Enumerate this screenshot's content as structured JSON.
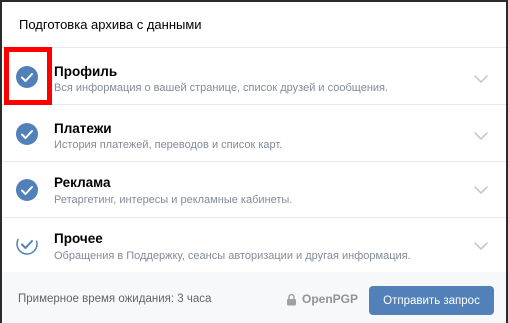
{
  "header": {
    "title": "Подготовка архива с данными"
  },
  "items": [
    {
      "label": "Профиль",
      "description": "Вся информация о вашей странице, список друзей и сообщения.",
      "checked": true
    },
    {
      "label": "Платежи",
      "description": "История платежей, переводов и список карт.",
      "checked": true
    },
    {
      "label": "Реклама",
      "description": "Ретаргетинг, интересы и рекламные кабинеты.",
      "checked": true
    },
    {
      "label": "Прочее",
      "description": "Обращения в Поддержку, сеансы авторизации и другая информация.",
      "checked": "partial"
    }
  ],
  "footer": {
    "wait_text": "Примерное время ожидания: 3 часа",
    "pgp_label": "OpenPGP",
    "send_label": "Отправить запрос"
  },
  "colors": {
    "accent": "#5181b8",
    "highlight": "#ff0000",
    "muted": "#818c99"
  }
}
